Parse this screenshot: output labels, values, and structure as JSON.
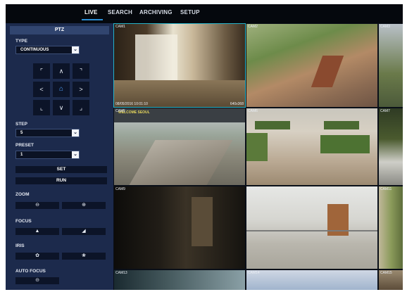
{
  "nav": {
    "tabs": [
      {
        "label": "LIVE",
        "active": true
      },
      {
        "label": "SEARCH",
        "active": false
      },
      {
        "label": "ARCHIVING",
        "active": false
      },
      {
        "label": "SETUP",
        "active": false
      }
    ]
  },
  "ptz": {
    "title": "PTZ",
    "type_label": "TYPE",
    "type_value": "CONTINUOUS",
    "step_label": "STEP",
    "step_value": "5",
    "preset_label": "PRESET",
    "preset_value": "1",
    "set_label": "SET",
    "run_label": "RUN",
    "zoom_label": "ZOOM",
    "focus_label": "FOCUS",
    "iris_label": "IRIS",
    "auto_focus_label": "AUTO FOCUS",
    "dropdown_arrow": "⌄",
    "dpad": {
      "ul": "⌜",
      "up": "∧",
      "ur": "⌝",
      "left": "<",
      "home": "⌂",
      "right": ">",
      "dl": "⌞",
      "down": "∨",
      "dr": "⌟"
    },
    "icons": {
      "zoom_out": "⊖",
      "zoom_in": "⊕",
      "focus_near": "▲",
      "focus_far": "◢",
      "iris_close": "✿",
      "iris_open": "❀",
      "auto_focus": "⊝"
    }
  },
  "cameras": [
    {
      "label": "CAM1",
      "timestamp": "08/05/2016 10:01:10",
      "resolution": "640x368",
      "selected": true
    },
    {
      "label": "CAM2"
    },
    {
      "label": "CAM3"
    },
    {
      "label": "CAM5",
      "banner": "WELCOME SEOUL"
    },
    {
      "label": "CAM6"
    },
    {
      "label": "CAM7"
    },
    {
      "label": "CAM9"
    },
    {
      "label": "CAM10"
    },
    {
      "label": "CAM11"
    },
    {
      "label": "CAM13"
    },
    {
      "label": "CAM14"
    },
    {
      "label": "CAM15"
    }
  ],
  "colors": {
    "panel_bg": "#1c2a4c",
    "accent": "#2b8fd6",
    "selected_border": "#26b3c9"
  }
}
